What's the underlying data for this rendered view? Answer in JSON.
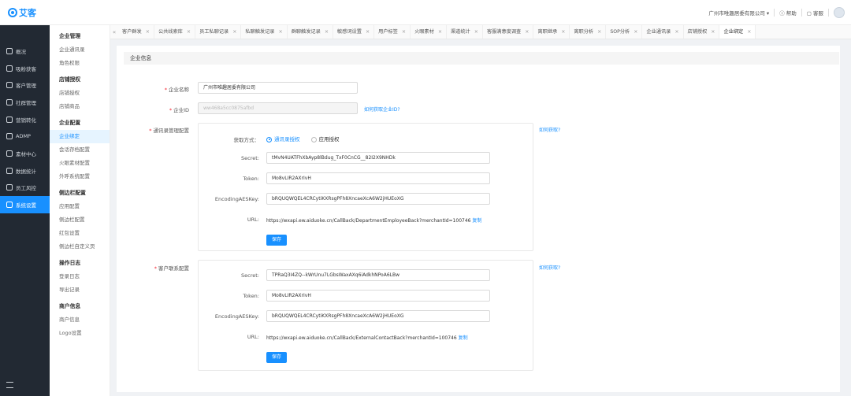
{
  "app": {
    "logo": "艾客"
  },
  "topbar": {
    "company": "广州市唯趣居委有限公司",
    "help": "帮助",
    "customer_service": "客服"
  },
  "sidebar": {
    "items": [
      {
        "label": "概况",
        "icon": "home-icon"
      },
      {
        "label": "吸粉获客",
        "icon": "user-plus-icon"
      },
      {
        "label": "客户管理",
        "icon": "users-icon"
      },
      {
        "label": "社群管理",
        "icon": "group-icon"
      },
      {
        "label": "营销转化",
        "icon": "marketing-icon"
      },
      {
        "label": "ADMP",
        "icon": "data-icon"
      },
      {
        "label": "素材中心",
        "icon": "material-icon"
      },
      {
        "label": "数据统计",
        "icon": "chart-icon"
      },
      {
        "label": "员工风控",
        "icon": "shield-icon"
      },
      {
        "label": "系统设置",
        "icon": "gear-icon",
        "active": true
      }
    ]
  },
  "submenu": {
    "groups": [
      {
        "title": "企业管理",
        "items": [
          "企业通讯录",
          "角色权限"
        ]
      },
      {
        "title": "店铺授权",
        "items": [
          "店铺授权",
          "店铺商品"
        ]
      },
      {
        "title": "企业配置",
        "items": [
          "企业绑定",
          "会话存档配置",
          "火眼素材配置",
          "外呼系统配置"
        ],
        "active": "企业绑定"
      },
      {
        "title": "侧边栏配置",
        "items": [
          "应用配置",
          "侧边栏配置",
          "红包设置",
          "侧边栏自定义页"
        ]
      },
      {
        "title": "操作日志",
        "items": [
          "登录日志",
          "导出记录"
        ]
      },
      {
        "title": "商户信息",
        "items": [
          "商户信息",
          "Logo设置"
        ]
      }
    ]
  },
  "tabs": {
    "items": [
      "客户群发",
      "公共线索库",
      "员工私聊记录",
      "私聊触发记录",
      "群聊触发记录",
      "敏感词设置",
      "用户标签",
      "火眼素材",
      "渠道统计",
      "客服满意度调查",
      "离职继承",
      "离职分析",
      "SOP分析",
      "企业通讯录",
      "店铺授权",
      "企业绑定"
    ],
    "active_index": 15
  },
  "form": {
    "section_title": "企业信息",
    "company_name_label": "企业名称",
    "company_name_value": "广州市唯趣居委有限公司",
    "corp_id_label": "企业ID",
    "corp_id_value": "ww468a5cc0875afbd",
    "corp_id_link": "如何获取企业ID?",
    "contacts": {
      "label": "通讯录管理配置",
      "how_link": "如何获取?",
      "mode_label": "获取方式：",
      "mode_options": [
        "通讯录授权",
        "应用授权"
      ],
      "secret_label": "Secret:",
      "secret_value": "tMvN4UATFhXbAyp8lBdug_TxF0CnCG__82I2X9NHDk",
      "token_label": "Token:",
      "token_value": "Mo8vLIR2AXrIvH",
      "aes_label": "EncodingAESKey:",
      "aes_value": "bRQUQWQEL4CRCytiKXRsgPFh8XncaeXcA6W2jHUEoXG",
      "url_label": "URL:",
      "url_value": "https://wxapi.ew.aiduoke.cn/CallBack/DepartmentEmployeeBack?merchantId=100746",
      "copy": "复制",
      "save": "保存"
    },
    "customer": {
      "label": "客户联系配置",
      "how_link": "如何获取?",
      "secret_label": "Secret:",
      "secret_value": "TPRaQ3I4ZQ--kWrUnu7LGbsWaxAXq6iAdkhNPoA6LBw",
      "token_label": "Token:",
      "token_value": "Mo8vLIR2AXrIvH",
      "aes_label": "EncodingAESKey:",
      "aes_value": "bRQUQWQEL4CRCytiKXRsgPFh8XncaeXcA6W2jHUEoXG",
      "url_label": "URL:",
      "url_value": "https://wxapi.ew.aiduoke.cn/CallBack/ExternalContactBack?merchantId=100746",
      "copy": "复制",
      "save": "保存"
    }
  }
}
